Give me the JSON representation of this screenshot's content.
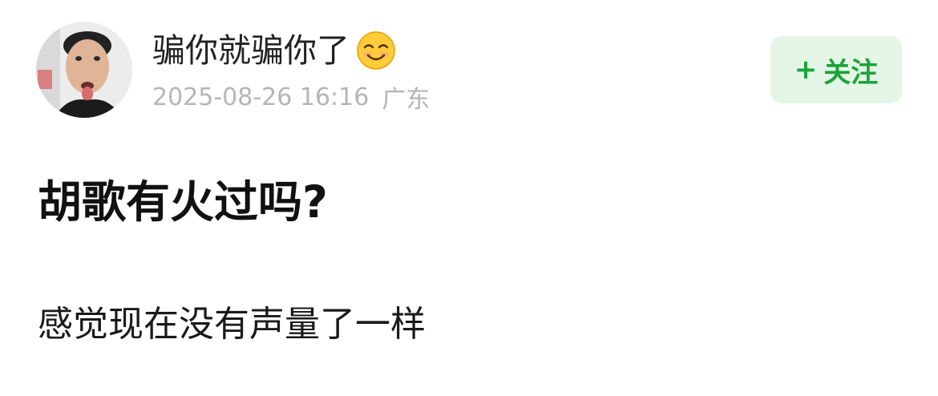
{
  "author": {
    "name": "骗你就骗你了",
    "name_emoji_icon": "smiling-face-icon",
    "avatar_icon": "user-avatar-photo"
  },
  "meta": {
    "timestamp": "2025-08-26 16:16",
    "location": "广东"
  },
  "follow_button": {
    "icon": "plus-icon",
    "plus": "+",
    "label": "关注",
    "accent_color": "#1aa33a",
    "background_color": "#e4f6e6"
  },
  "post": {
    "title": "胡歌有火过吗?",
    "body": "感觉现在没有声量了一样"
  }
}
